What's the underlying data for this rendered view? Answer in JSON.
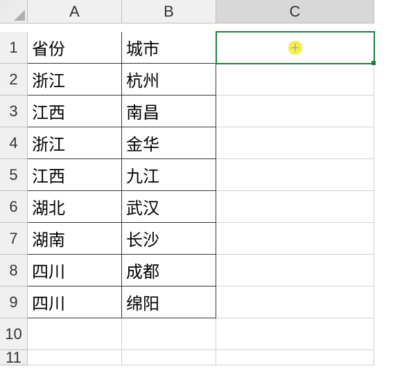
{
  "columns": [
    "A",
    "B",
    "C"
  ],
  "rows": [
    "1",
    "2",
    "3",
    "4",
    "5",
    "6",
    "7",
    "8",
    "9",
    "10",
    "11"
  ],
  "selected_cell": "C1",
  "selected_column": "C",
  "chart_data": {
    "type": "table",
    "headers": [
      "省份",
      "城市"
    ],
    "data": [
      {
        "A": "省份",
        "B": "城市"
      },
      {
        "A": "浙江",
        "B": "杭州"
      },
      {
        "A": "江西",
        "B": "南昌"
      },
      {
        "A": "浙江",
        "B": "金华"
      },
      {
        "A": "江西",
        "B": "九江"
      },
      {
        "A": "湖北",
        "B": "武汉"
      },
      {
        "A": "湖南",
        "B": "长沙"
      },
      {
        "A": "四川",
        "B": "成都"
      },
      {
        "A": "四川",
        "B": "绵阳"
      }
    ]
  }
}
